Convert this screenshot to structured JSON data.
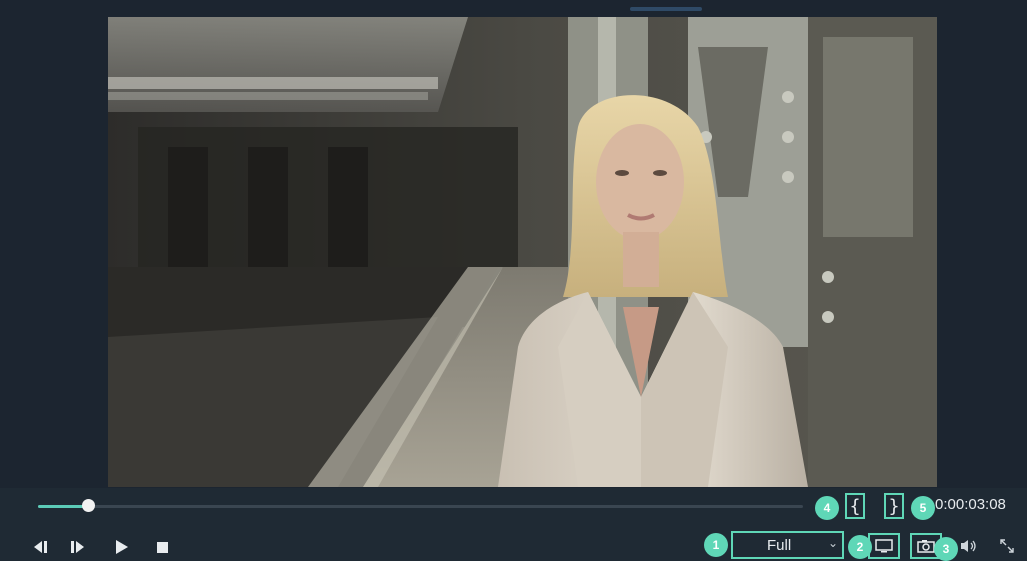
{
  "player": {
    "timecode": "0:00:03:08",
    "progress_fraction": 0.065,
    "quality_select": {
      "selected": "Full"
    },
    "mark_in_label": "{",
    "mark_out_label": "}"
  },
  "buttons": {
    "prev_frame": "prev-frame-icon",
    "next_frame": "next-frame-icon",
    "play": "play-icon",
    "stop": "stop-icon",
    "display": "monitor-icon",
    "snapshot": "camera-icon",
    "volume": "volume-icon",
    "fullscreen": "fullscreen-icon"
  },
  "annotations": {
    "m1": "1",
    "m2": "2",
    "m3": "3",
    "m4": "4",
    "m5": "5",
    "color": "#5fd7b7"
  }
}
